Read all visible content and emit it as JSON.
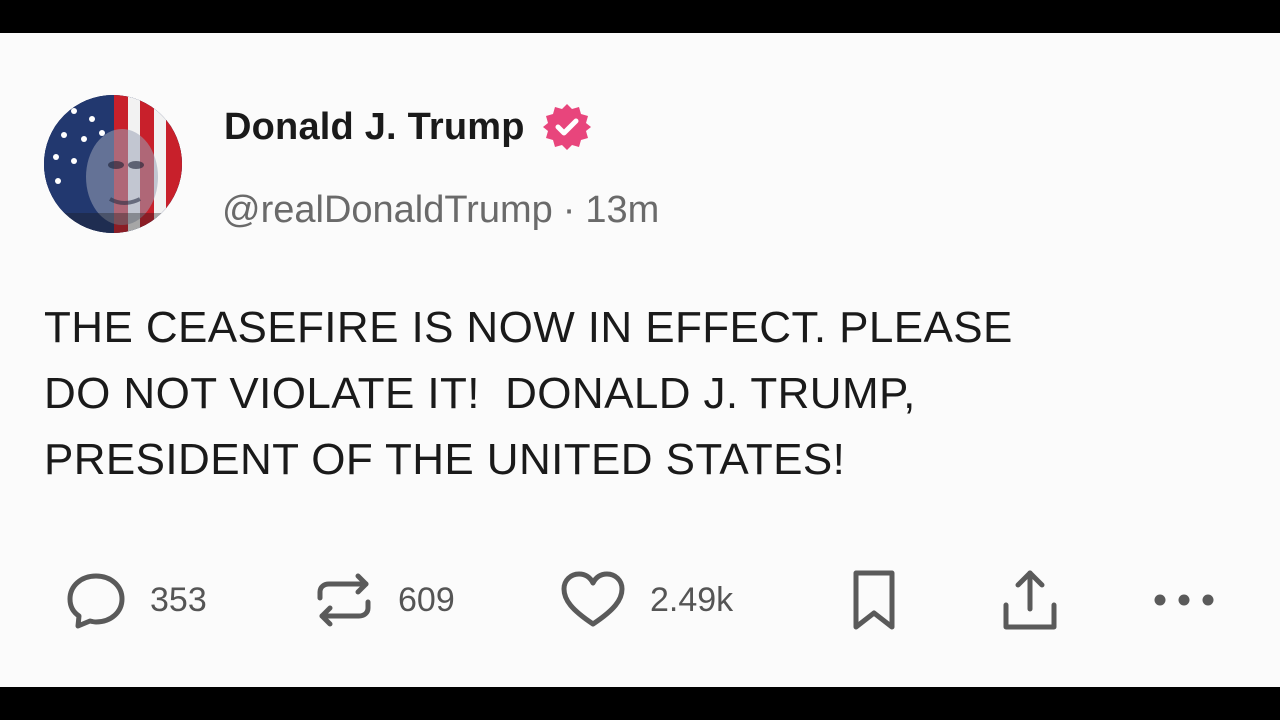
{
  "post": {
    "display_name": "Donald J. Trump",
    "handle": "@realDonaldTrump",
    "separator": "·",
    "timestamp": "13m",
    "body": "THE CEASEFIRE IS NOW IN EFFECT. PLEASE\nDO NOT VIOLATE IT!  DONALD J. TRUMP,\nPRESIDENT OF THE UNITED STATES!",
    "verified_icon": "verified-check-icon",
    "verified_color": "#e8457c"
  },
  "actions": {
    "reply": {
      "icon": "reply-bubble-icon",
      "count": "353"
    },
    "repost": {
      "icon": "repost-arrows-icon",
      "count": "609"
    },
    "like": {
      "icon": "heart-icon",
      "count": "2.49k"
    },
    "bookmark": {
      "icon": "bookmark-icon"
    },
    "share": {
      "icon": "share-upload-icon"
    },
    "more": {
      "icon": "more-dots-icon"
    }
  }
}
